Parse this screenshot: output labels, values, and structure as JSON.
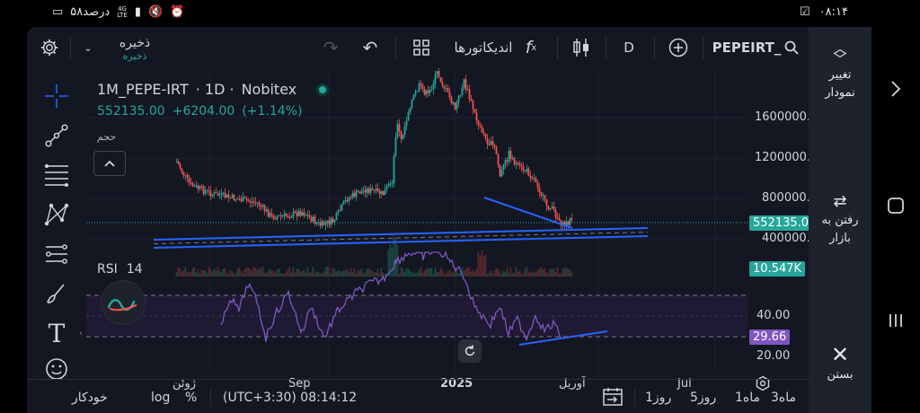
{
  "status": {
    "time": "۰۸:۱۴",
    "battery": "۵۸درصد",
    "net_top": "4G",
    "net_bottom": "LTE"
  },
  "toolbar": {
    "symbol": "PEPEIRT_",
    "interval": "D",
    "indicators_label": "اندیکاتورها",
    "save_label": "ذخیره",
    "save_sub": "ذخیره"
  },
  "legend": {
    "title": "1M_PEPE-IRT",
    "interval": "· 1D ·",
    "exchange": "Nobitex",
    "price": "552135.00",
    "change": "+6204.00",
    "change_pct": "(+1.14%)",
    "volume_label": "حجم"
  },
  "rsi": {
    "label": "RSI",
    "period": "14"
  },
  "price_axis": {
    "labels": [
      "1600000.00",
      "1200000.00",
      "800000.00",
      "400000.00"
    ],
    "current_price_tag": "552135.00",
    "volume_tag": "10.547K",
    "rsi_labels": [
      "40.00",
      "20.00"
    ],
    "rsi_tag": "29.66"
  },
  "time_axis": {
    "labels": [
      "ژوئن",
      "Sep",
      "2025",
      "آوریل",
      "Jul"
    ]
  },
  "bottombar": {
    "timezone": "(UTC+3:30) 08:14:12",
    "percent": "%",
    "log": "log",
    "auto": "خودکار",
    "ranges": [
      "3ماه",
      "1ماه",
      "5روز",
      "1روز"
    ]
  },
  "rightpanel": {
    "change_chart": "تغییر نمودار",
    "go_market": "رفتن به بازار",
    "close": "بستن"
  },
  "colors": {
    "background": "#131722",
    "up": "#26a69a",
    "down": "#ef5350",
    "trendline": "#2962ff",
    "rsi": "#7e57c2",
    "rsi_band": "#1f1a33"
  }
}
